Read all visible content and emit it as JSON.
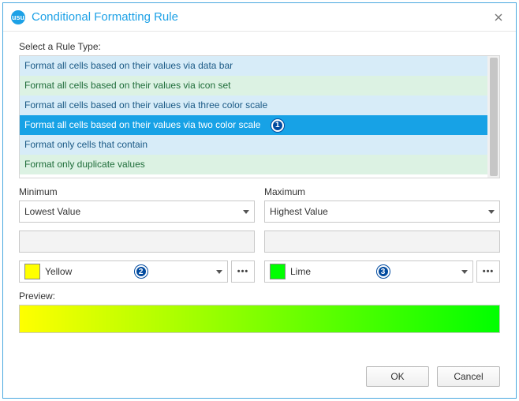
{
  "window": {
    "title": "Conditional Formatting Rule"
  },
  "ruleType": {
    "label": "Select a Rule Type:",
    "items": [
      "Format all cells based on their values via data bar",
      "Format all cells based on their values via icon set",
      "Format all cells based on their values via three color scale",
      "Format all cells based on their values via two color scale",
      "Format only cells that contain",
      "Format only duplicate values"
    ],
    "selectedIndex": 3
  },
  "callouts": {
    "c1": "1",
    "c2": "2",
    "c3": "3"
  },
  "minimum": {
    "label": "Minimum",
    "comboValue": "Lowest Value",
    "colorName": "Yellow",
    "colorHex": "#ffff00"
  },
  "maximum": {
    "label": "Maximum",
    "comboValue": "Highest Value",
    "colorName": "Lime",
    "colorHex": "#00ff00"
  },
  "preview": {
    "label": "Preview:"
  },
  "footer": {
    "ok": "OK",
    "cancel": "Cancel"
  }
}
